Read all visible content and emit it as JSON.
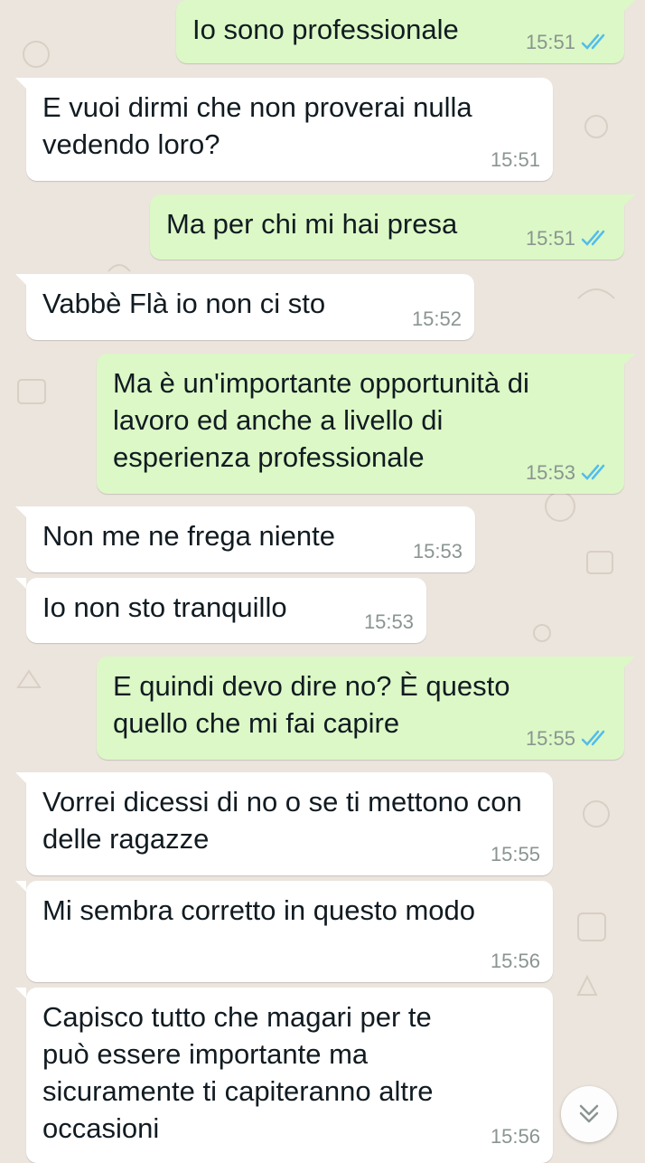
{
  "theme": {
    "out_bubble": "#dcf8c6",
    "in_bubble": "#ffffff",
    "tick_color": "#53bdeb"
  },
  "messages": [
    {
      "dir": "out",
      "text": "Io sono professionale",
      "time": "15:51",
      "status": "read"
    },
    {
      "dir": "in",
      "text": "E vuoi dirmi che non proverai nulla vedendo loro?",
      "time": "15:51"
    },
    {
      "dir": "out",
      "text": "Ma per chi mi hai presa",
      "time": "15:51",
      "status": "read"
    },
    {
      "dir": "in",
      "text": "Vabbè Flà io non ci sto",
      "time": "15:52"
    },
    {
      "dir": "out",
      "text": "Ma è un'importante opportunità di lavoro ed anche a livello di esperienza professionale",
      "time": "15:53",
      "status": "read"
    },
    {
      "dir": "in",
      "text": "Non me ne frega niente",
      "time": "15:53"
    },
    {
      "dir": "in",
      "text": "Io non sto tranquillo",
      "time": "15:53"
    },
    {
      "dir": "out",
      "text": "E quindi devo dire no? È questo quello che mi fai capire",
      "time": "15:55",
      "status": "read"
    },
    {
      "dir": "in",
      "text": "Vorrei dicessi di no o se ti mettono con delle ragazze",
      "time": "15:55"
    },
    {
      "dir": "in",
      "text": "Mi sembra corretto in questo modo",
      "time": "15:56"
    },
    {
      "dir": "in",
      "text": "Capisco tutto che magari per te può essere importante ma sicuramente ti capiteranno altre occasioni",
      "time": "15:56"
    }
  ],
  "scroll_button": {
    "icon": "double-chevron-down-icon"
  }
}
